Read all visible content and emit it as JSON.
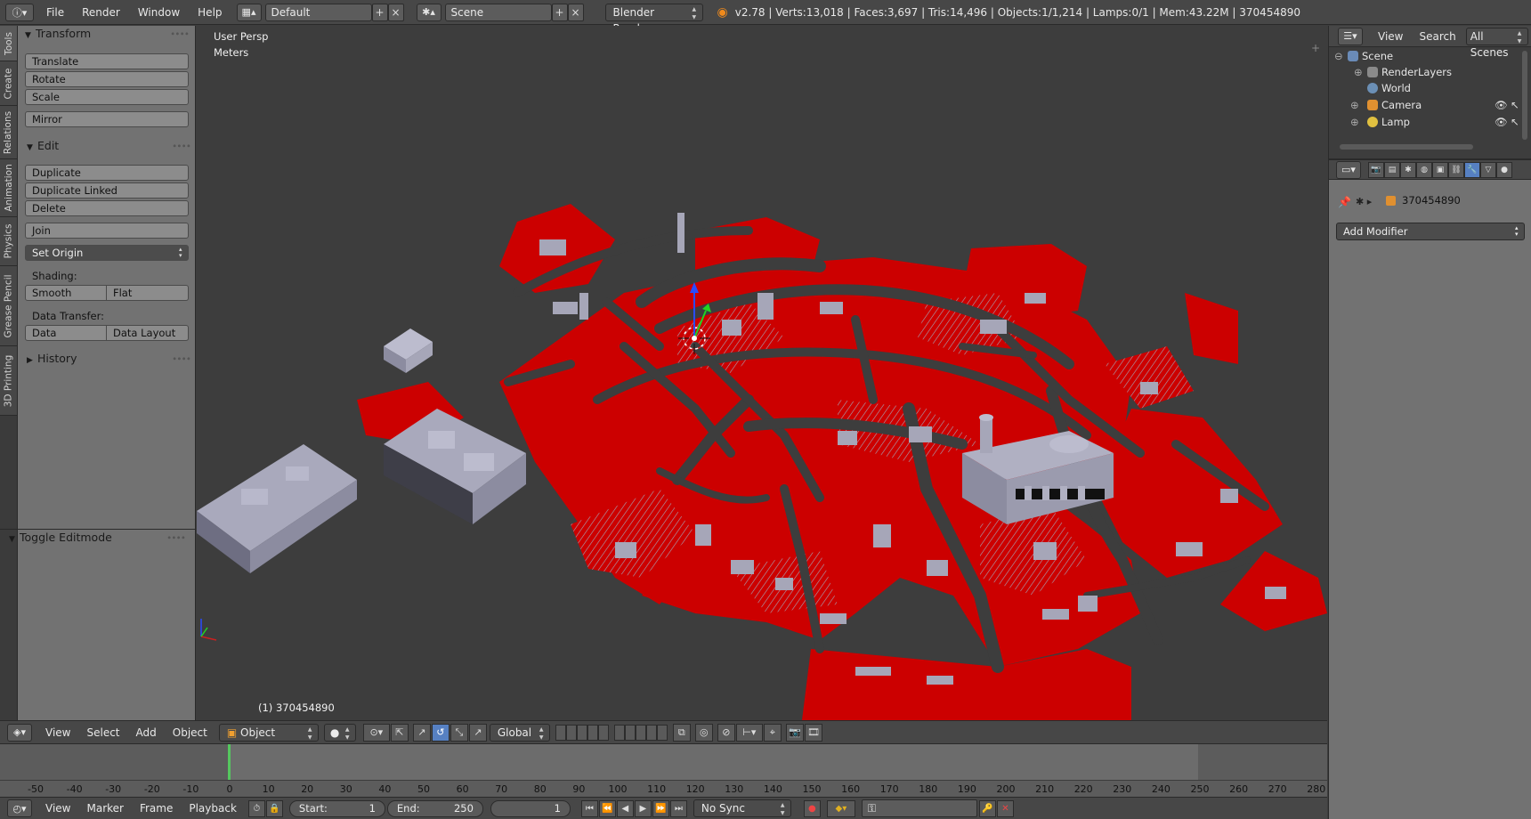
{
  "topbar": {
    "info_icon": "info-icon",
    "menus": [
      "File",
      "Render",
      "Window",
      "Help"
    ],
    "screen_layout": "Default",
    "scene": "Scene",
    "engine": "Blender Render",
    "stats": "v2.78 | Verts:13,018 | Faces:3,697 | Tris:14,496 | Objects:1/1,214 | Lamps:0/1 | Mem:43.22M | 370454890"
  },
  "toolshelf": {
    "tabs": [
      "Tools",
      "Create",
      "Relations",
      "Animation",
      "Physics",
      "Grease Pencil",
      "3D Printing"
    ],
    "transform": {
      "title": "Transform",
      "buttons": [
        "Translate",
        "Rotate",
        "Scale",
        "Mirror"
      ]
    },
    "edit": {
      "title": "Edit",
      "buttons": [
        "Duplicate",
        "Duplicate Linked",
        "Delete",
        "Join"
      ],
      "set_origin": "Set Origin",
      "shading_label": "Shading:",
      "smooth": "Smooth",
      "flat": "Flat",
      "data_transfer_label": "Data Transfer:",
      "data": "Data",
      "data_layout": "Data Layout"
    },
    "history": "History",
    "toggle_editmode": "Toggle Editmode"
  },
  "viewport": {
    "view_name": "User Persp",
    "units": "Meters",
    "object_label": "(1) 370454890"
  },
  "view3d_header": {
    "menus": [
      "View",
      "Select",
      "Add",
      "Object"
    ],
    "mode": "Object Mode",
    "orientation": "Global"
  },
  "timeline": {
    "ticks": [
      "-50",
      "-40",
      "-30",
      "-20",
      "-10",
      "0",
      "10",
      "20",
      "30",
      "40",
      "50",
      "60",
      "70",
      "80",
      "90",
      "100",
      "110",
      "120",
      "130",
      "140",
      "150",
      "160",
      "170",
      "180",
      "190",
      "200",
      "210",
      "220",
      "230",
      "240",
      "250",
      "260",
      "270",
      "280"
    ],
    "current_frame": "1"
  },
  "timeline_header": {
    "menus": [
      "View",
      "Marker",
      "Frame",
      "Playback"
    ],
    "start_label": "Start:",
    "start_value": "1",
    "end_label": "End:",
    "end_value": "250",
    "frame": "1",
    "sync": "No Sync"
  },
  "outliner": {
    "tabs": [
      "View",
      "Search",
      "All Scenes"
    ],
    "items": [
      {
        "label": "Scene",
        "icon": "scene-icon"
      },
      {
        "label": "RenderLayers",
        "icon": "renderlayers-icon"
      },
      {
        "label": "World",
        "icon": "world-icon"
      },
      {
        "label": "Camera",
        "icon": "camera-icon"
      },
      {
        "label": "Lamp",
        "icon": "lamp-icon"
      }
    ]
  },
  "properties": {
    "object_name": "370454890",
    "add_modifier": "Add Modifier"
  },
  "colors": {
    "roof_red": "#cc0000",
    "building_gray": "#a6a6b8",
    "ground": "#3d3d3d",
    "active_blue": "#5680c2",
    "playhead": "#55c75f"
  }
}
